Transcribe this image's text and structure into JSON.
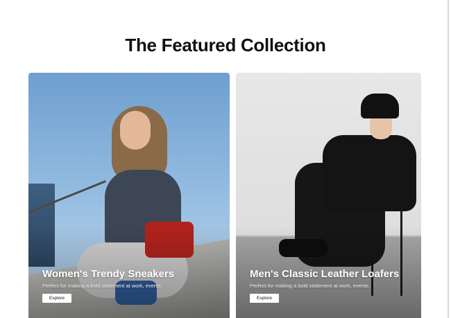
{
  "section": {
    "title": "The Featured Collection"
  },
  "cards": [
    {
      "heading": "Women's Trendy Sneakers",
      "description": "Perfect for making a bold statement at work, events.",
      "button_label": "Explore",
      "image": "woman-sitting-on-stairs-photo"
    },
    {
      "heading": "Men's Classic Leather Loafers",
      "description": "Perfect for making a bold statement at work, events.",
      "button_label": "Explore",
      "image": "man-sitting-on-chair-photo"
    }
  ],
  "colors": {
    "title_text": "#111111",
    "card_text": "#ffffff",
    "button_bg": "#ffffff"
  }
}
